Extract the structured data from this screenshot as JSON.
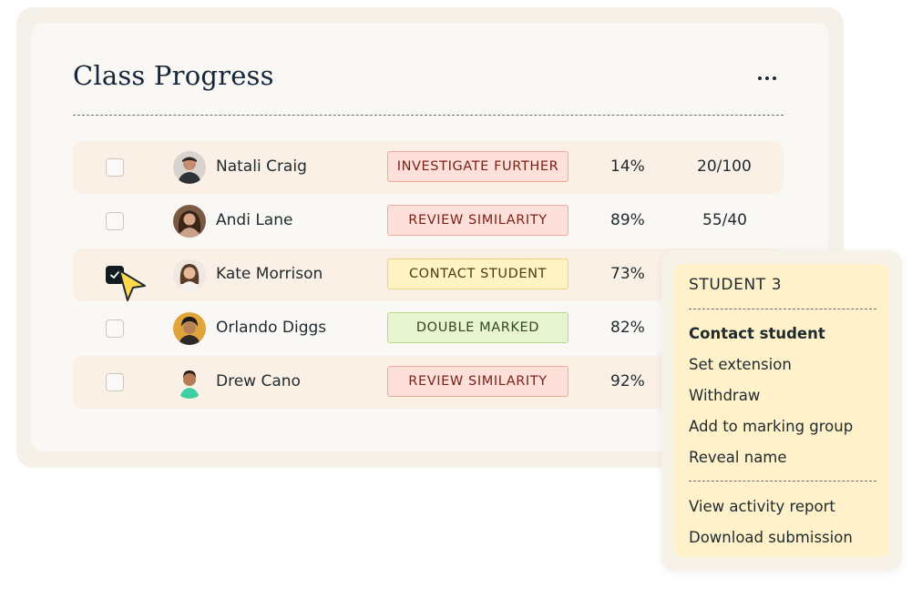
{
  "panel": {
    "title": "Class Progress",
    "more_label": "..."
  },
  "students": [
    {
      "name": "Natali Craig",
      "status": "INVESTIGATE FURTHER",
      "status_color": "red",
      "percent": "14%",
      "score": "20/100",
      "checked": false
    },
    {
      "name": "Andi Lane",
      "status": "REVIEW SIMILARITY",
      "status_color": "red",
      "percent": "89%",
      "score": "55/40",
      "checked": false
    },
    {
      "name": "Kate Morrison",
      "status": "CONTACT STUDENT",
      "status_color": "yellow",
      "percent": "73%",
      "score": "",
      "checked": true
    },
    {
      "name": "Orlando Diggs",
      "status": "DOUBLE MARKED",
      "status_color": "green",
      "percent": "82%",
      "score": "",
      "checked": false
    },
    {
      "name": "Drew Cano",
      "status": "REVIEW SIMILARITY",
      "status_color": "red",
      "percent": "92%",
      "score": "",
      "checked": false
    }
  ],
  "context_menu": {
    "title": "STUDENT 3",
    "items_group1": [
      "Contact student",
      "Set extension",
      "Withdraw",
      "Add to marking group",
      "Reveal name"
    ],
    "items_group2": [
      "View activity report",
      "Download submission"
    ]
  },
  "colors": {
    "badge_red_bg": "#fde0d9",
    "badge_yellow_bg": "#fff3c4",
    "badge_green_bg": "#e8f3d2",
    "menu_bg": "#fff1c9",
    "cursor_fill": "#ffd84d"
  },
  "icons": {
    "more": "more-horizontal-icon",
    "check": "checkmark-icon",
    "cursor": "mouse-pointer-icon"
  }
}
